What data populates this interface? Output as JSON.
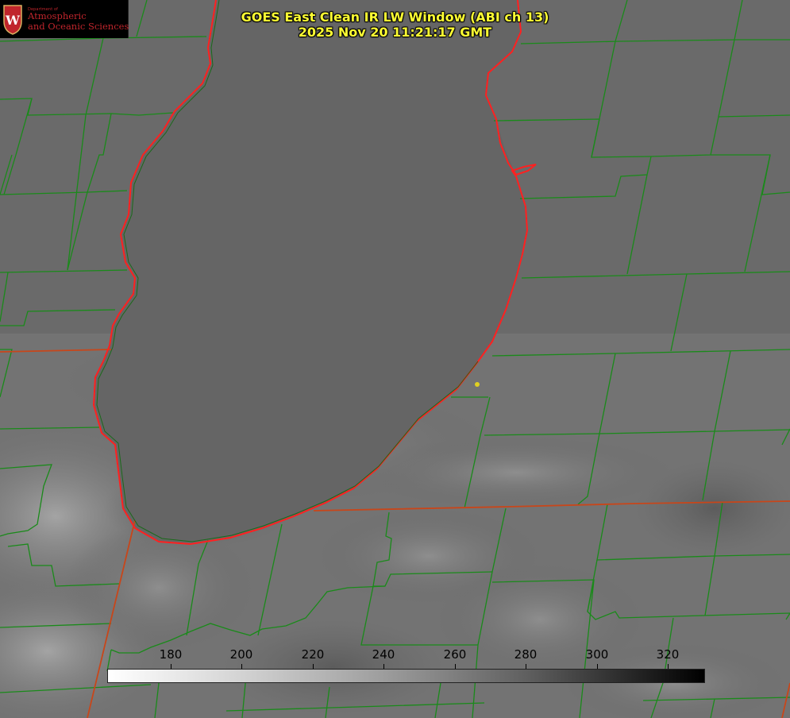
{
  "title": {
    "line1": "GOES East Clean IR LW Window (ABI ch 13)",
    "line2": "2025 Nov 20 11:21:17 GMT"
  },
  "logo": {
    "dept": "Department of",
    "line1": "Atmospheric",
    "line2": "and Oceanic Sciences",
    "mark": "W"
  },
  "colorbar": {
    "ticks": [
      "180",
      "200",
      "220",
      "240",
      "260",
      "280",
      "300",
      "320"
    ]
  },
  "colors": {
    "county_lines": "#1a8a1a",
    "state_lines": "#c8461a",
    "lake_outline": "#ff2020",
    "title": "#ffff33",
    "station_dot": "#e0d020"
  }
}
